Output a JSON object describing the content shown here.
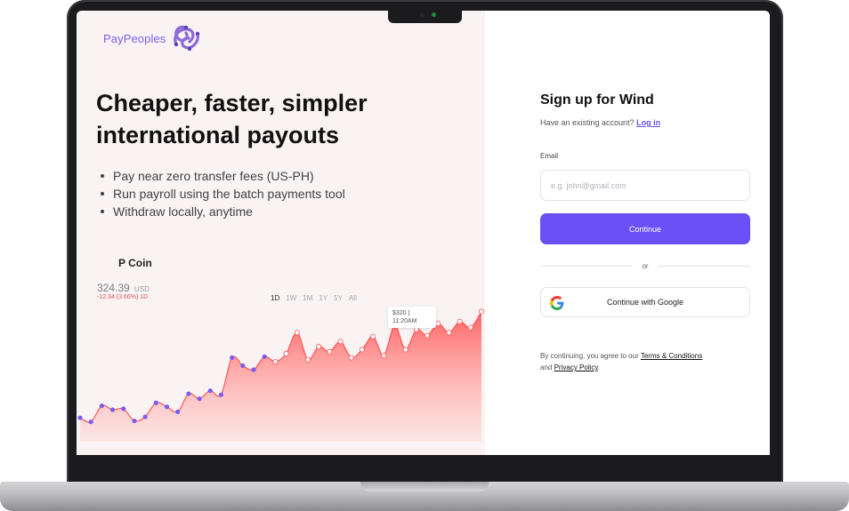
{
  "brand": {
    "name": "PayPeoples",
    "logo_icon": "knot-logo-icon",
    "color": "#7a5cf0"
  },
  "hero": {
    "title_line1": "Cheaper, faster, simpler",
    "title_line2": "international payouts",
    "features": [
      "Pay near zero transfer fees (US-PH)",
      "Run payroll using the batch payments tool",
      "Withdraw locally, anytime"
    ]
  },
  "coin": {
    "name": "P Coin",
    "price": "324.39",
    "currency": "USD",
    "change": "-12.34 (3.66%) 1D",
    "ranges": [
      "1D",
      "1W",
      "1M",
      "1Y",
      "5Y",
      "All"
    ],
    "active_range": "1D",
    "tooltip_value": "$320 |",
    "tooltip_time": "11:20AM"
  },
  "chart_data": {
    "type": "area",
    "title": "",
    "xlabel": "",
    "ylabel": "",
    "x": [
      1,
      2,
      3,
      4,
      5,
      6,
      7,
      8,
      9,
      10,
      11,
      12,
      13,
      14,
      15,
      16,
      17,
      18,
      19,
      20,
      21,
      22,
      23,
      24,
      25,
      26,
      27,
      28,
      29,
      30,
      31,
      32,
      33,
      34,
      35,
      36,
      37,
      38
    ],
    "values": [
      22,
      18,
      34,
      30,
      31,
      19,
      23,
      37,
      33,
      28,
      46,
      41,
      49,
      45,
      82,
      74,
      70,
      83,
      78,
      86,
      107,
      80,
      93,
      88,
      98,
      82,
      90,
      103,
      84,
      114,
      90,
      110,
      104,
      116,
      107,
      118,
      112,
      128
    ],
    "point_colors": [
      "#7c5cf0",
      "#7c5cf0",
      "#7c5cf0",
      "#7c5cf0",
      "#7c5cf0",
      "#7c5cf0",
      "#7c5cf0",
      "#7c5cf0",
      "#7c5cf0",
      "#7c5cf0",
      "#7c5cf0",
      "#7c5cf0",
      "#7c5cf0",
      "#7c5cf0",
      "#7c5cf0",
      "#7c5cf0",
      "#7c5cf0",
      "#7c5cf0",
      "#ffffff",
      "#ffffff",
      "#ffffff",
      "#ffffff",
      "#ffffff",
      "#ffffff",
      "#ffffff",
      "#ffffff",
      "#ffffff",
      "#ffffff",
      "#ffffff",
      "#ffffff",
      "#ffffff",
      "#ffffff",
      "#ffffff",
      "#ffffff",
      "#ffffff",
      "#ffffff",
      "#ffffff",
      "#ffffff"
    ],
    "ylim": [
      0,
      132
    ],
    "grid": false,
    "fill_color": "#ff6a6a",
    "line_color": "#ff5555"
  },
  "signup": {
    "title": "Sign up for Wind",
    "existing_prompt": "Have an existing account?",
    "login_label": "Log in",
    "email_label": "Email",
    "email_value": "",
    "email_placeholder": "e.g. john@gmail.com",
    "continue_label": "Continue",
    "or_label": "or",
    "google_label": "Continue with Google",
    "google_icon": "google-icon",
    "accent_color": "#6b50f5",
    "terms_prefix": "By continuing, you agree to our",
    "terms_link": "Terms & Conditions",
    "terms_and": "and",
    "privacy_link": "Privacy Policy",
    "terms_suffix": "."
  }
}
